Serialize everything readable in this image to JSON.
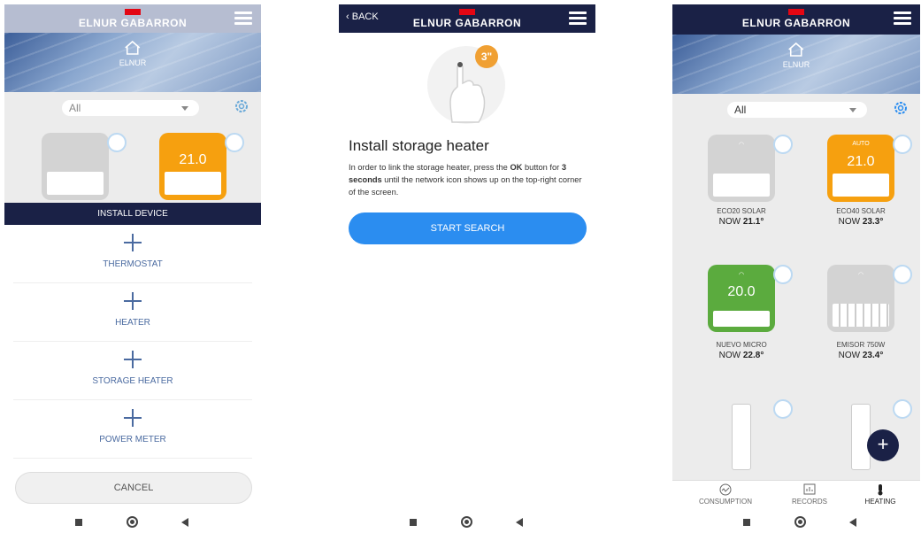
{
  "brand": "ELNUR GABARRON",
  "colors": {
    "header": "#1a2146",
    "accent_red": "#e30613",
    "primary_blue": "#2b8df0",
    "orange": "#f6a00f",
    "green": "#5bab3e"
  },
  "left": {
    "home_label": "",
    "filter_value": "All",
    "device_temp": "21.0",
    "sheet_title": "INSTALL DEVICE",
    "options": [
      {
        "label": "THERMOSTAT",
        "icon": "plus-icon"
      },
      {
        "label": "HEATER",
        "icon": "plus-icon"
      },
      {
        "label": "STORAGE HEATER",
        "icon": "plus-icon"
      },
      {
        "label": "POWER METER",
        "icon": "plus-icon"
      }
    ],
    "cancel": "CANCEL"
  },
  "middle": {
    "back": "BACK",
    "step": "3\"",
    "title": "Install storage heater",
    "desc_1": "In order to link the storage heater, press the ",
    "desc_ok": "OK",
    "desc_2": " button for ",
    "desc_sec": "3 seconds",
    "desc_3": " until the network icon shows up on the top-right corner of the screen.",
    "start": "START SEARCH"
  },
  "right": {
    "home_label": "ELNUR",
    "filter_value": "All",
    "devices": [
      {
        "name": "ECO20 SOLAR",
        "now_prefix": "NOW ",
        "now": "21.1°",
        "temp": ""
      },
      {
        "name": "ECO40 SOLAR",
        "now_prefix": "NOW ",
        "now": "23.3°",
        "temp": "21.0",
        "mode": "AUTO"
      },
      {
        "name": "NUEVO MICRO",
        "now_prefix": "NOW ",
        "now": "22.8°",
        "temp": "20.0"
      },
      {
        "name": "EMISOR 750W",
        "now_prefix": "NOW ",
        "now": "23.4°",
        "temp": ""
      }
    ],
    "tabs": [
      {
        "label": "CONSUMPTION",
        "icon": "consumption-icon"
      },
      {
        "label": "RECORDS",
        "icon": "records-icon"
      },
      {
        "label": "HEATING",
        "icon": "thermometer-icon"
      }
    ],
    "fab": "+"
  }
}
